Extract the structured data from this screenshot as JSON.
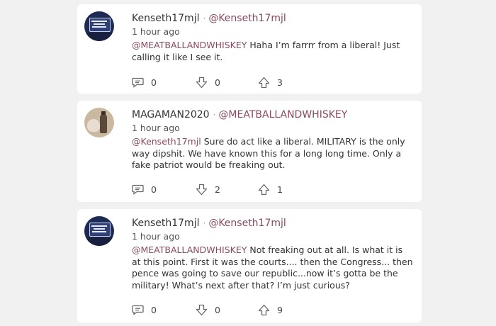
{
  "comments": [
    {
      "username": "Kenseth17mjl",
      "separator": "·",
      "reply_to": "@Kenseth17mjl",
      "time": "1 hour ago",
      "mention": "@MEATBALLANDWHISKEY",
      "text": " Haha I’m farrrr from a liberal! Just calling it like I see it.",
      "avatar": "wisconsin-sign-avatar",
      "comment_count": "0",
      "downvote_count": "0",
      "upvote_count": "3"
    },
    {
      "username": "MAGAMAN2020",
      "separator": "·",
      "reply_to": "@MEATBALLANDWHISKEY",
      "time": "1 hour ago",
      "mention": "@Kenseth17mjl",
      "text": " Sure do act like a liberal. MILITARY is the only way dipshit. We have known this for a long long time. Only a fake patriot would be freaking out.",
      "avatar": "dog-and-bottle-avatar",
      "comment_count": "0",
      "downvote_count": "2",
      "upvote_count": "1"
    },
    {
      "username": "Kenseth17mjl",
      "separator": "·",
      "reply_to": "@Kenseth17mjl",
      "time": "1 hour ago",
      "mention": "@MEATBALLANDWHISKEY",
      "text": " Not freaking out at all. Is what it is at this point. First it was the courts.... then the Congress... then pence was going to save our republic...now it’s gotta be the military! What’s next after that? I’m just curious?",
      "avatar": "wisconsin-sign-avatar",
      "comment_count": "0",
      "downvote_count": "0",
      "upvote_count": "9"
    }
  ],
  "colors": {
    "background": "#f1f1f1",
    "card": "#ffffff",
    "mention": "#8a4a5c",
    "text": "#333333"
  },
  "icons": {
    "comment": "speech-bubble-icon",
    "downvote": "down-arrow-icon",
    "upvote": "up-arrow-icon"
  }
}
